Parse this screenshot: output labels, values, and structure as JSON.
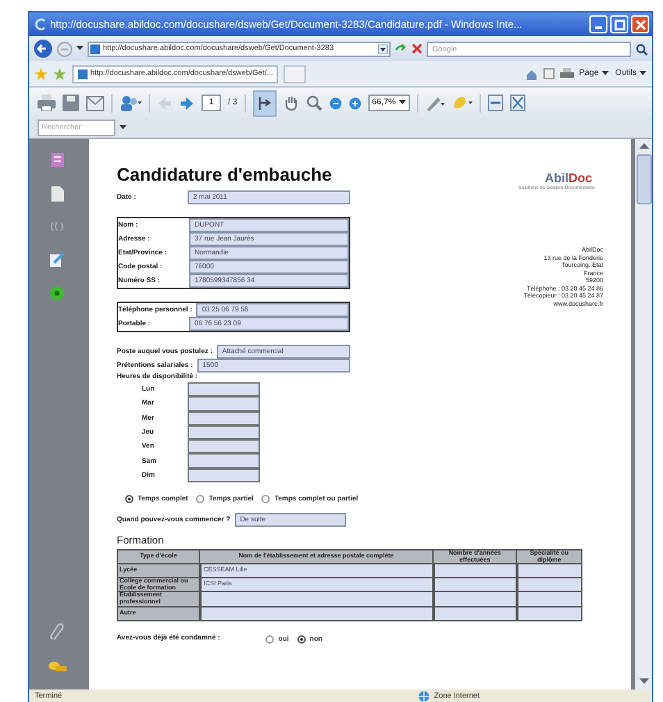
{
  "window": {
    "title": "http://docushare.abildoc.com/docushare/dsweb/Get/Document-3283/Candidature.pdf - Windows Inte..."
  },
  "nav": {
    "address": "http://docushare.abildoc.com/docushare/dsweb/Get/Document-3283",
    "search_placeholder": "Google"
  },
  "favorites": {
    "tab": "http://docushare.abildoc.com/docushare/dsweb/Get/...",
    "menus": [
      "Page",
      "Outils"
    ]
  },
  "pdf_toolbar": {
    "page": "1",
    "page_count": "/ 3",
    "zoom": "66,7%"
  },
  "find": {
    "placeholder": "Rechercher"
  },
  "document": {
    "title": "Candidature d'embauche",
    "logo_left": "Abil",
    "logo_right": "Doc",
    "tagline": "Solutions de Gestion Documentaire",
    "field_groups": [
      {
        "kind": "plain",
        "fields": [
          {
            "label": "Date :",
            "value": "2 mai 2011"
          }
        ]
      },
      {
        "kind": "boxed",
        "fields": [
          {
            "label": "Nom :",
            "value": "DUPONT"
          },
          {
            "label": "Adresse :",
            "value": "37 rue Jean Jaurès"
          },
          {
            "label": "Etat/Province :",
            "value": "Normandie"
          },
          {
            "label": "Code postal :",
            "value": "76000"
          },
          {
            "label": "Numéro SS :",
            "value": "1780599347856 34"
          }
        ]
      },
      {
        "kind": "boxed",
        "fields": [
          {
            "label": "Téléphone personnel :",
            "value": "03 25 06 79 56"
          },
          {
            "label": "Portable :",
            "value": "06 76 56 23 09"
          }
        ]
      },
      {
        "kind": "plain",
        "fields": [
          {
            "label": "Poste auquel vous postulez :",
            "value": "Attaché commercial"
          },
          {
            "label": "Prétentions salariales :",
            "value": "1500"
          }
        ]
      }
    ],
    "company_address": [
      "AbilDoc",
      "13 rue de la Fonderie",
      "Tourcoing, Etat",
      "France",
      "59200",
      "Téléphone : 03 20 45 24 86",
      "Télécopieur : 03 20 45 24 87",
      "www.docushare.fr"
    ],
    "availability": {
      "label": "Heures de disponibilité :",
      "days": [
        "Lun",
        "Mar",
        "Mer",
        "Jeu",
        "Ven",
        "Sam",
        "Dim"
      ]
    },
    "schedule_options": [
      {
        "label": "Temps complet",
        "selected": true
      },
      {
        "label": "Temps partiel",
        "selected": false
      },
      {
        "label": "Temps complet ou partiel",
        "selected": false
      }
    ],
    "start": {
      "label": "Quand pouvez-vous commencer ?",
      "value": "De suite"
    },
    "formation": {
      "title": "Formation",
      "columns": [
        "Type d'école",
        "Nom de l'établissement et adresse postale complète",
        "Nombre d'années effectuées",
        "Spécialité ou diplôme"
      ],
      "rows": [
        {
          "type": "Lycée",
          "school": "CESSEAM Lille"
        },
        {
          "type": "Collège commercial ou Ecole de formation",
          "school": "ICSI Paris"
        },
        {
          "type": "Etablissement professionnel"
        },
        {
          "type": "Autre"
        }
      ]
    },
    "conviction": {
      "label": "Avez-vous déjà été condamné :",
      "options": [
        {
          "label": "oui",
          "selected": false
        },
        {
          "label": "non",
          "selected": true
        }
      ]
    }
  },
  "status_bar": {
    "left": "Terminé",
    "zone": "Zone Internet"
  }
}
